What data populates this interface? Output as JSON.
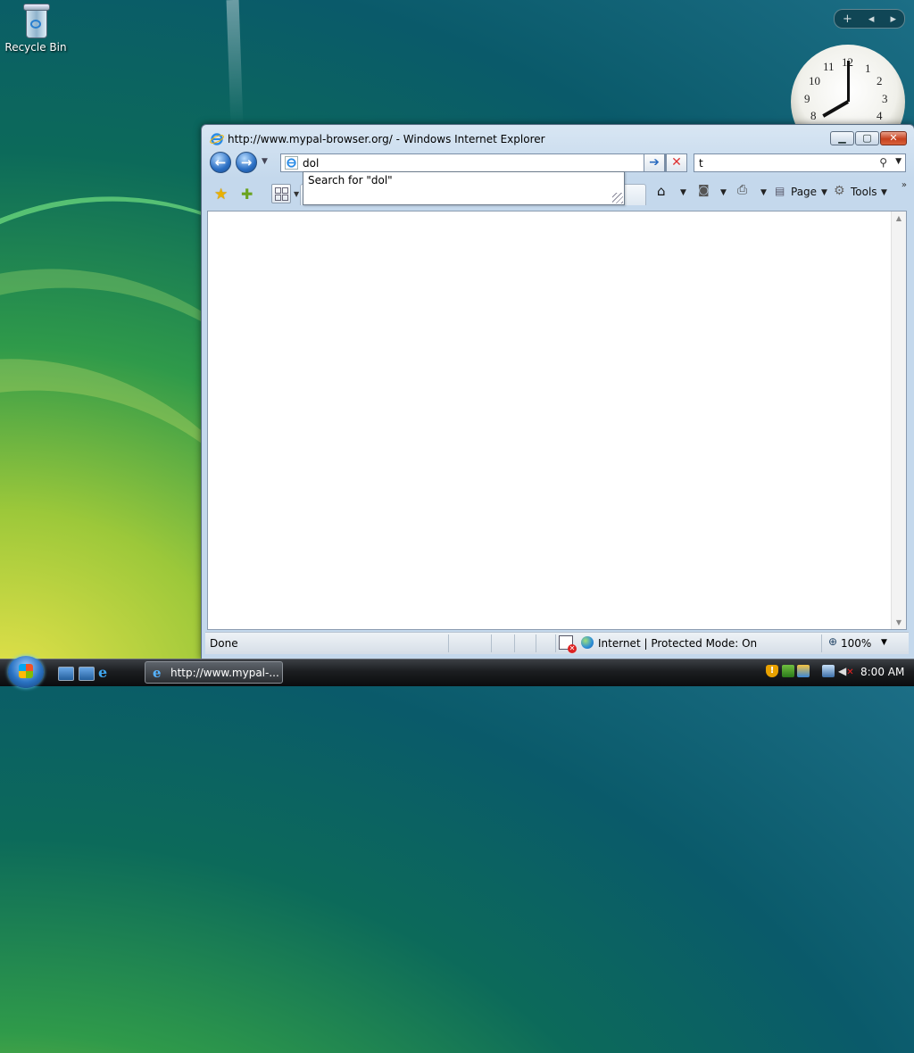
{
  "desktop": {
    "recycle_bin_label": "Recycle Bin"
  },
  "gadgets": {
    "add_label": "+",
    "prev_label": "◂",
    "next_label": "▸",
    "clock_numbers": [
      "12",
      "1",
      "2",
      "3",
      "4",
      "8",
      "9",
      "10",
      "11"
    ],
    "clock_time": "8:00"
  },
  "window": {
    "title": "http://www.mypal-browser.org/ - Windows Internet Explorer",
    "minimize_glyph": "▁",
    "maximize_glyph": "▢",
    "close_glyph": "✕"
  },
  "navbar": {
    "back_glyph": "←",
    "forward_glyph": "→",
    "address_value": "dol",
    "go_glyph": "➔",
    "stop_glyph": "✕",
    "search_value": "t"
  },
  "autocomplete": {
    "item": "Search for \"dol\""
  },
  "commandbar": {
    "home_glyph": "⌂",
    "feeds_glyph": "◙",
    "print_glyph": "⎙",
    "page_label": "Page",
    "tools_label": "Tools",
    "chevrons": "»"
  },
  "statusbar": {
    "status": "Done",
    "zone": "Internet | Protected Mode: On",
    "zoom": "100%"
  },
  "taskbar": {
    "task_label": "http://www.mypal-...",
    "time": "8:00 AM"
  },
  "colors": {
    "window_frame": "#c4d8ec",
    "close_button": "#c6411f",
    "taskbar": "#1b1d20",
    "nav_button": "#2b6fc4"
  }
}
